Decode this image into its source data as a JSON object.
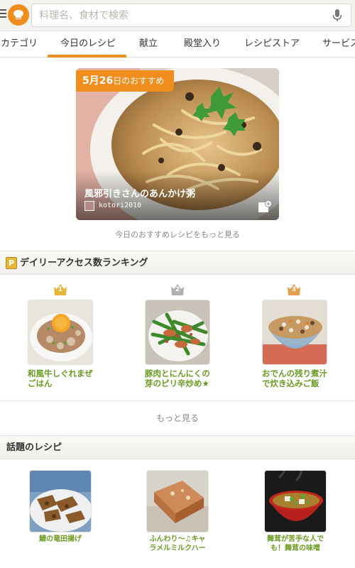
{
  "search": {
    "placeholder": "料理名、食材で検索"
  },
  "tabs": [
    {
      "label": "カテゴリ"
    },
    {
      "label": "今日のレシピ"
    },
    {
      "label": "献立"
    },
    {
      "label": "殿堂入り"
    },
    {
      "label": "レシピストア"
    },
    {
      "label": "サービス"
    }
  ],
  "featured": {
    "badge_date_number": "5月26",
    "badge_suffix": "日のおすすめ",
    "title": "風邪引きさんのあんかけ粥",
    "author": "kotori2010",
    "more_link": "今日のおすすめレシピをもっと見る"
  },
  "ranking": {
    "title": "デイリーアクセス数ランキング",
    "items": [
      {
        "rank": "1",
        "name_line1": "和風牛しぐれまぜ",
        "name_line2": "ごはん"
      },
      {
        "rank": "2",
        "name_line1": "豚肉とにんにくの",
        "name_line2": "芽のピリ辛炒め★"
      },
      {
        "rank": "3",
        "name_line1": "おでんの残り煮汁",
        "name_line2": "で炊き込みご飯"
      }
    ],
    "more_link": "もっと見る"
  },
  "topics": {
    "title": "話題のレシピ",
    "items": [
      {
        "name_line1": "鯖の竜田揚げ",
        "name_line2": ""
      },
      {
        "name_line1": "ふんわり～♫キャ",
        "name_line2": "ラメルミルクハー"
      },
      {
        "name_line1": "舞茸が苦手な人で",
        "name_line2": "も！舞茸の味噌"
      }
    ]
  },
  "colors": {
    "accent": "#f08d1c",
    "recipe_link": "#6a9a1f",
    "rank1": "#e6b63c",
    "rank2": "#b0b0b0",
    "rank3": "#e0a050"
  }
}
